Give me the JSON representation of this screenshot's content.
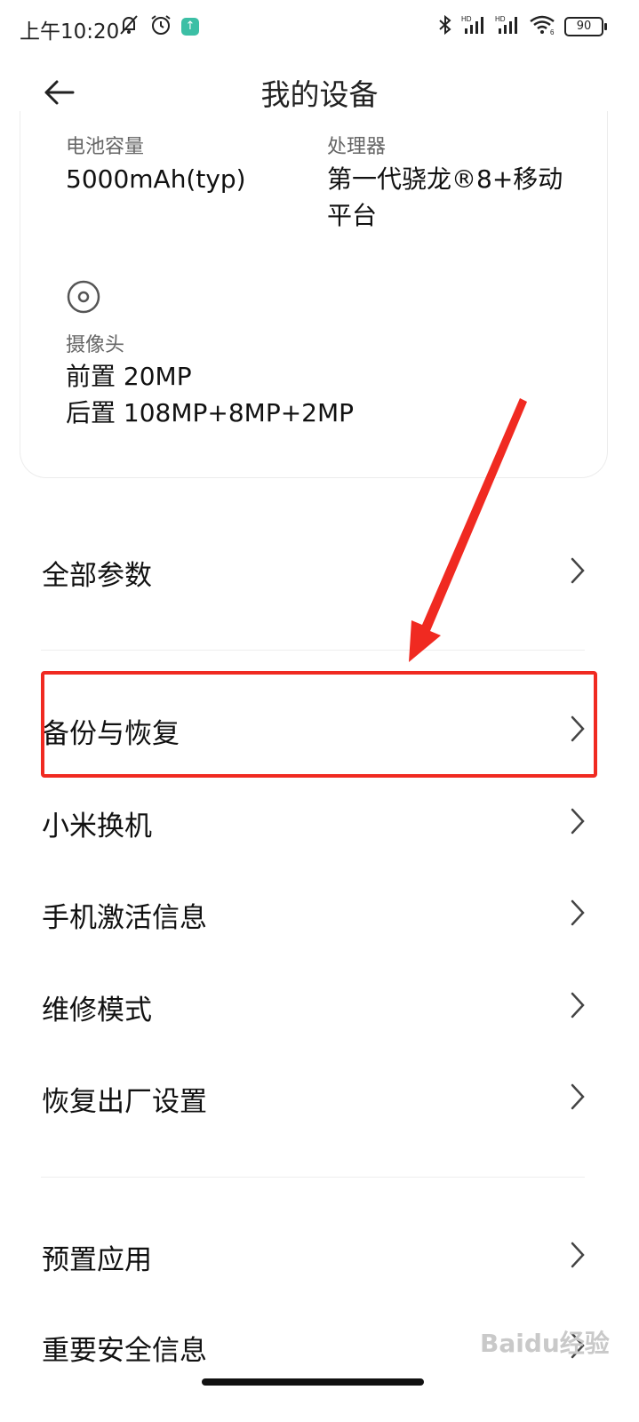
{
  "status_bar": {
    "time": "上午10:20",
    "left_icons": [
      "mute-notification-icon",
      "alarm-icon",
      "app-notification-icon"
    ],
    "right_icons": [
      "bluetooth-icon",
      "signal-hd-icon",
      "signal-hd-icon",
      "wifi-icon",
      "battery-icon"
    ],
    "battery_level": "90",
    "signal_labels": [
      "HD",
      "HD"
    ],
    "wifi_label": "6"
  },
  "header": {
    "title": "我的设备",
    "back_icon": "back-arrow-icon"
  },
  "specs": {
    "battery_label": "电池容量",
    "battery_value": "5000mAh(typ)",
    "processor_label": "处理器",
    "processor_value_line1": "第一代骁龙®8+移动",
    "processor_value_line2": "平台",
    "camera_icon": "camera-icon",
    "camera_label": "摄像头",
    "camera_front": "前置 20MP",
    "camera_rear": "后置 108MP+8MP+2MP"
  },
  "menu": {
    "all_params": "全部参数",
    "backup_restore": "备份与恢复",
    "mi_mover": "小米换机",
    "activation_info": "手机激活信息",
    "repair_mode": "维修模式",
    "factory_reset": "恢复出厂设置",
    "preinstalled_apps": "预置应用",
    "safety_info": "重要安全信息"
  },
  "annotation": {
    "highlight_color": "#f02a21",
    "arrow_color": "#f02a21"
  },
  "watermark": {
    "text": "Baidu经验"
  }
}
